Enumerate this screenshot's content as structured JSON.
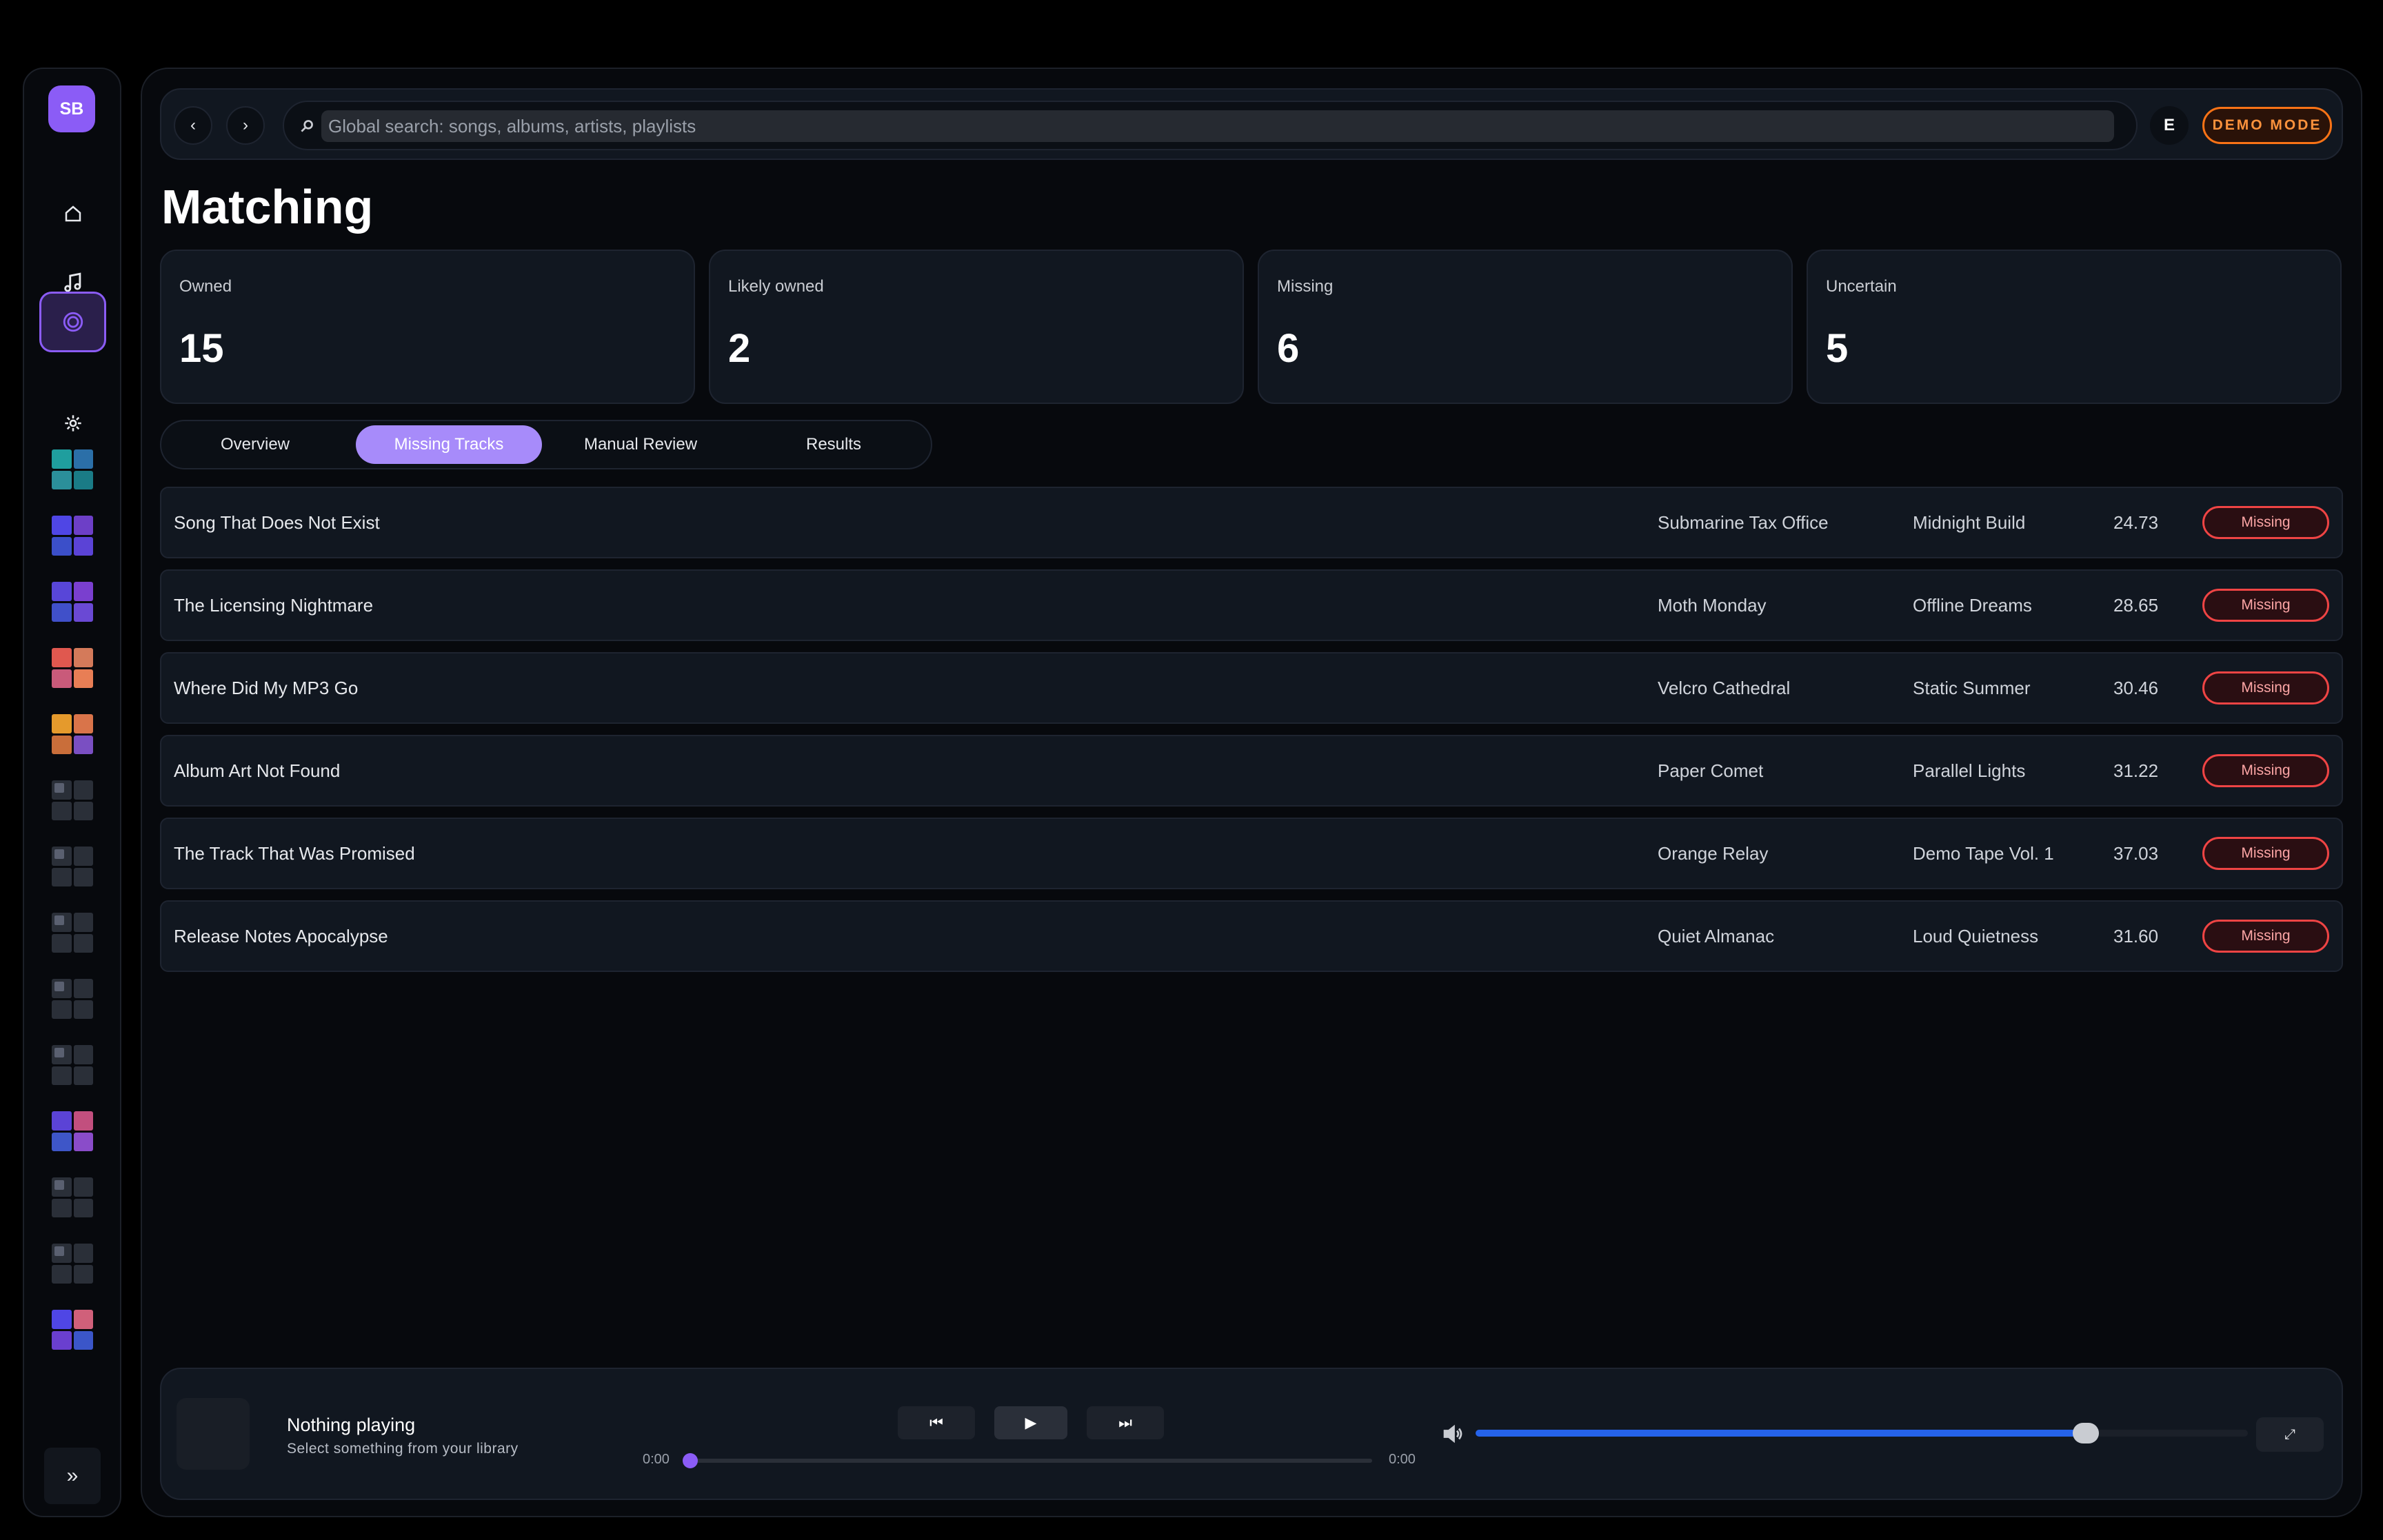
{
  "sidebar": {
    "avatar_initials": "SB",
    "nav": [
      {
        "name": "home-icon"
      },
      {
        "name": "music-note-icon"
      },
      {
        "name": "matching-icon",
        "active": true
      },
      {
        "name": "gear-icon"
      }
    ],
    "expand_label": "»"
  },
  "topbar": {
    "back_label": "‹",
    "forward_label": "›",
    "search_placeholder": "Global search: songs, albums, artists, playlists",
    "user_initial": "E",
    "demo_label": "DEMO MODE"
  },
  "page": {
    "title": "Matching"
  },
  "stats": [
    {
      "label": "Owned",
      "value": "15"
    },
    {
      "label": "Likely owned",
      "value": "2"
    },
    {
      "label": "Missing",
      "value": "6"
    },
    {
      "label": "Uncertain",
      "value": "5"
    }
  ],
  "tabs": [
    {
      "label": "Overview"
    },
    {
      "label": "Missing Tracks",
      "active": true
    },
    {
      "label": "Manual Review"
    },
    {
      "label": "Results"
    }
  ],
  "tracks": [
    {
      "title": "Song That Does Not Exist",
      "artist": "Submarine Tax Office",
      "album": "Midnight Build",
      "score": "24.73",
      "status": "Missing"
    },
    {
      "title": "The Licensing Nightmare",
      "artist": "Moth Monday",
      "album": "Offline Dreams",
      "score": "28.65",
      "status": "Missing"
    },
    {
      "title": "Where Did My MP3 Go",
      "artist": "Velcro Cathedral",
      "album": "Static Summer",
      "score": "30.46",
      "status": "Missing"
    },
    {
      "title": "Album Art Not Found",
      "artist": "Paper Comet",
      "album": "Parallel Lights",
      "score": "31.22",
      "status": "Missing"
    },
    {
      "title": "The Track That Was Promised",
      "artist": "Orange Relay",
      "album": "Demo Tape Vol. 1",
      "score": "37.03",
      "status": "Missing"
    },
    {
      "title": "Release Notes Apocalypse",
      "artist": "Quiet Almanac",
      "album": "Loud Quietness",
      "score": "31.60",
      "status": "Missing"
    }
  ],
  "player": {
    "title": "Nothing playing",
    "subtitle": "Select something from your library",
    "prev_label": "⏮",
    "play_label": "▶",
    "next_label": "⏭",
    "time_current": "0:00",
    "time_total": "0:00",
    "volume_percent": 79,
    "fullscreen_label": "⤢"
  },
  "colors": {
    "accent": "#8b5cf6",
    "demo": "#f97316",
    "missing": "#ef4444",
    "volume": "#2563eb"
  }
}
